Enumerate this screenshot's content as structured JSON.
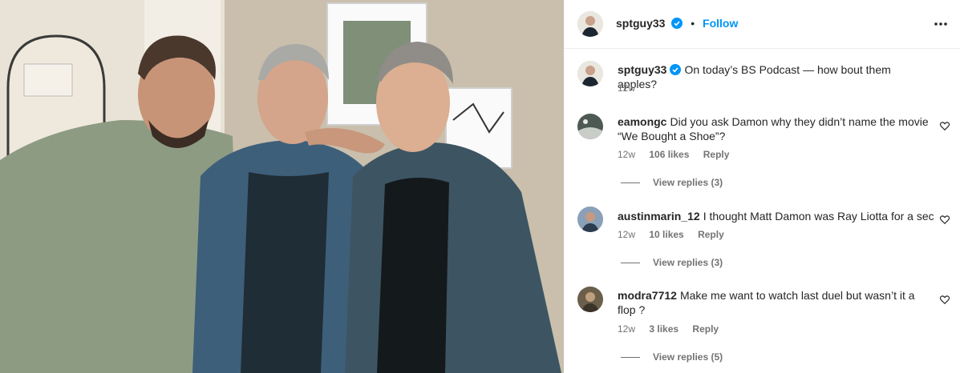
{
  "post": {
    "author": "sptguy33",
    "follow_label": "Follow",
    "dot": "•",
    "caption": "On today’s BS Podcast — how bout them apples?",
    "caption_age": "12w"
  },
  "comments": [
    {
      "user": "eamongc",
      "text": "Did you ask Damon why they didn’t name the movie “We Bought a Shoe”?",
      "age": "12w",
      "likes": "106 likes",
      "reply": "Reply",
      "view_replies": "View replies (3)"
    },
    {
      "user": "austinmarin_12",
      "text": "I thought Matt Damon was Ray Liotta for a sec",
      "age": "12w",
      "likes": "10 likes",
      "reply": "Reply",
      "view_replies": "View replies (3)"
    },
    {
      "user": "modra7712",
      "text": "Make me want to watch last duel but wasn’t it a flop ?",
      "age": "12w",
      "likes": "3 likes",
      "reply": "Reply",
      "view_replies": "View replies (5)"
    }
  ],
  "icons": {
    "verified": "verified-badge-icon",
    "more": "more-options-icon",
    "like": "heart-icon"
  },
  "colors": {
    "link": "#0095f6",
    "text": "#262626",
    "secondary": "#737373",
    "verified": "#0095f6"
  }
}
